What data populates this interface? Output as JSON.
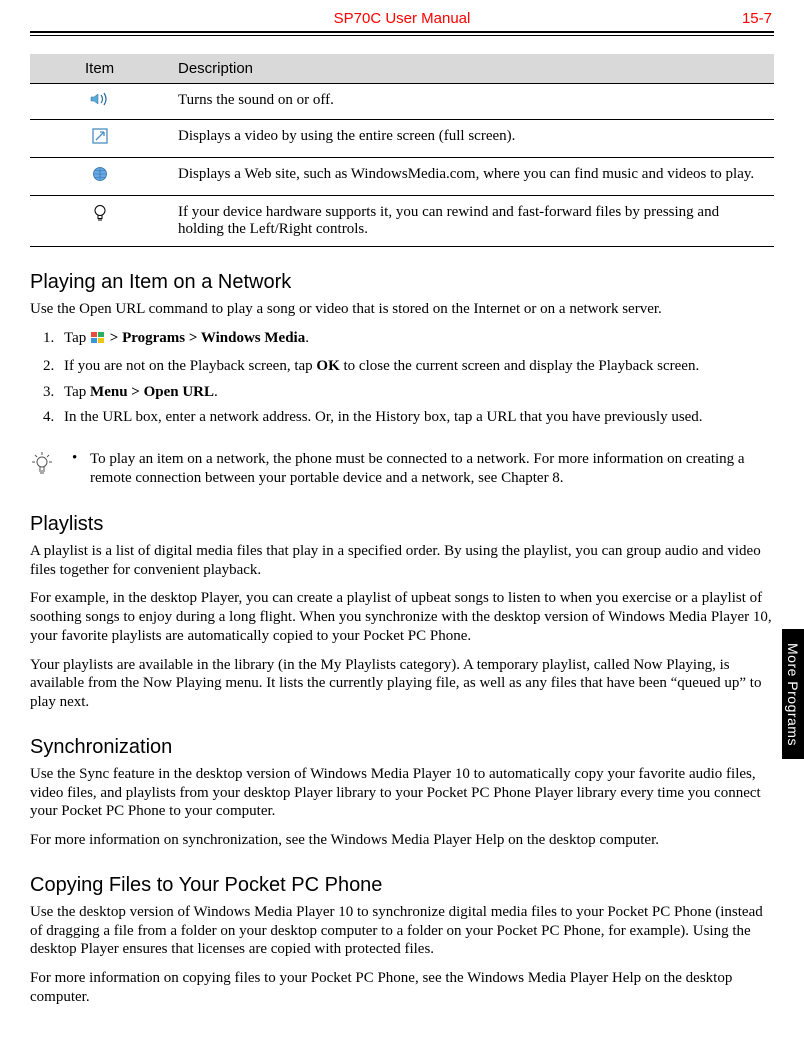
{
  "header": {
    "title": "SP70C User Manual",
    "pagenum": "15-7"
  },
  "table": {
    "head": {
      "item": "Item",
      "desc": "Description"
    },
    "rows": [
      {
        "icon": "sound-icon",
        "desc": "Turns the sound on or off."
      },
      {
        "icon": "fullscreen-icon",
        "desc": "Displays a video by using the entire screen (full screen)."
      },
      {
        "icon": "web-icon",
        "desc": "Displays a Web site, such as WindowsMedia.com, where you can find music and videos to play."
      },
      {
        "icon": "bulb-icon",
        "desc": "If your device hardware supports it, you can rewind and fast-forward files by pressing and holding the Left/Right controls."
      }
    ]
  },
  "sections": {
    "network": {
      "heading": "Playing an Item on a Network",
      "intro": "Use the Open URL command to play a song or video that is stored on the Internet or on a network server.",
      "step1_a": "Tap ",
      "step1_b": " > Programs > Windows Media",
      "step1_c": ".",
      "step2_a": "If you are not on the Playback screen, tap ",
      "step2_b": "OK",
      "step2_c": " to close the current screen and display the Playback screen.",
      "step3_a": "Tap ",
      "step3_b": "Menu > Open URL",
      "step3_c": ".",
      "step4": "In the URL box, enter a network address. Or, in the History box, tap a URL that you have previously used."
    },
    "tip": {
      "bullet": "•",
      "text": "To play an item on a network, the phone must be connected to a network. For more information on creating a remote connection between your portable device and a network, see Chapter 8."
    },
    "playlists": {
      "heading": "Playlists",
      "p1": "A playlist is a list of digital media files that play in a specified order. By using the playlist, you can group audio and video files together for convenient playback.",
      "p2": "For example, in the desktop Player, you can create a playlist of upbeat songs to listen to when you exercise or a playlist of soothing songs to enjoy during a long flight. When you synchronize with the desktop version of Windows Media Player 10, your favorite playlists are automatically copied to your Pocket PC Phone.",
      "p3": "Your playlists are available in the library (in the My Playlists category). A temporary playlist, called Now Playing, is available from the Now Playing menu. It lists the currently playing file, as well as any files that have been “queued up” to play next."
    },
    "sync": {
      "heading": "Synchronization",
      "p1": "Use the Sync feature in the desktop version of Windows Media Player 10 to automatically copy your favorite audio files, video files, and playlists from your desktop Player library to your Pocket PC Phone Player library every time you connect your Pocket PC Phone to your computer.",
      "p2": "For more information on synchronization, see the Windows Media Player Help on the desktop computer."
    },
    "copy": {
      "heading": "Copying Files to Your Pocket PC Phone",
      "p1": "Use the desktop version of Windows Media Player 10 to synchronize digital media files to your Pocket PC Phone (instead of dragging a file from a folder on your desktop computer to a folder on your Pocket PC Phone, for example). Using the desktop Player ensures that licenses are copied with protected files.",
      "p2": "For more information on copying files to your Pocket PC Phone, see the Windows Media Player Help on the desktop computer."
    }
  },
  "sidetab": "More Programs"
}
